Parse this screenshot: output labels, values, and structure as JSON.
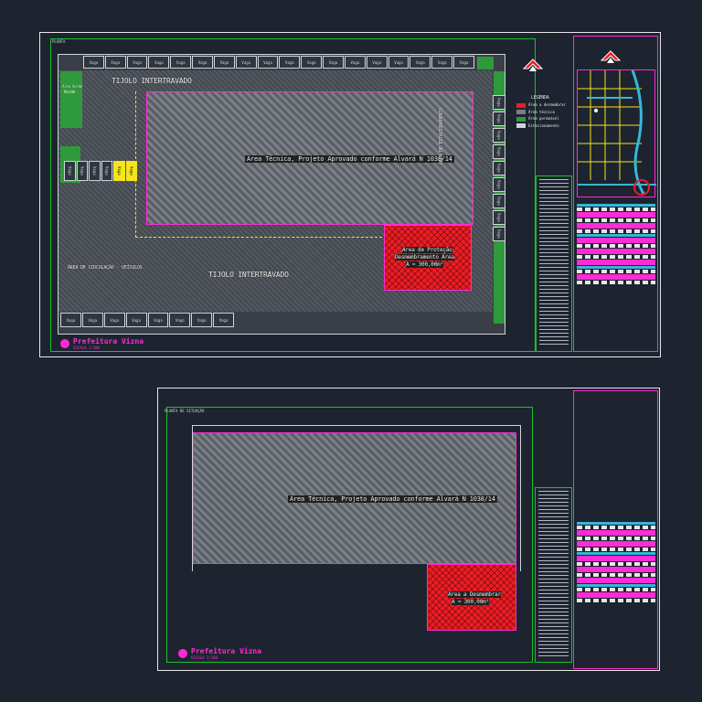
{
  "sheet1": {
    "corner_label": "PLANTA",
    "hatched_area_label": "Área Técnica, Projeto Aprovado conforme Alvará N 1038/14",
    "red_area_label_line1": "Área de Proteção",
    "red_area_label_line2": "Desmembramento Área",
    "red_area_label_line3": "A = 300,00m²",
    "road_label_top": "TIJOLO INTERTRAVADO",
    "road_label_bottom": "TIJOLO INTERTRAVADO",
    "road_label_left": "ÁREA DE CIRCULAÇÃO - VEÍCULOS",
    "road_label_right": "ÁREA DE ESTACIONAMENTO",
    "green_top_label": "Área Verde",
    "green_left_label": "Verde",
    "stall_label": "Vaga",
    "top_stall_count": 18,
    "bottom_stall_count": 8,
    "right_stall_count": 9,
    "logo_text": "Prefeitura Vizna",
    "logo_sub": "ESCALA 1:500"
  },
  "legend": {
    "title": "LEGENDA",
    "items": [
      {
        "label": "Área a desmembrar",
        "color": "#ee1c24"
      },
      {
        "label": "Área técnica",
        "color": "#7b7f86"
      },
      {
        "label": "Área permeável",
        "color": "#2f9a3c"
      },
      {
        "label": "Estacionamento",
        "color": "#cfd3d8"
      }
    ]
  },
  "sheet2": {
    "corner_label": "PLANTA DE SITUAÇÃO",
    "hatched_area_label": "Área Técnica, Projeto Aprovado conforme Alvará N 1038/14",
    "red_area_label_line1": "Área a Desmembrar",
    "red_area_label_line2": "A = 300,00m²",
    "logo_text": "Prefeitura Vizna",
    "logo_sub": "ESCALA 1:500"
  },
  "colors": {
    "background": "#1d2430",
    "frame_green": "#17c42a",
    "frame_magenta": "#ff2bd6",
    "area_red": "#ee1c24",
    "road_yellow": "#f5e51b"
  }
}
